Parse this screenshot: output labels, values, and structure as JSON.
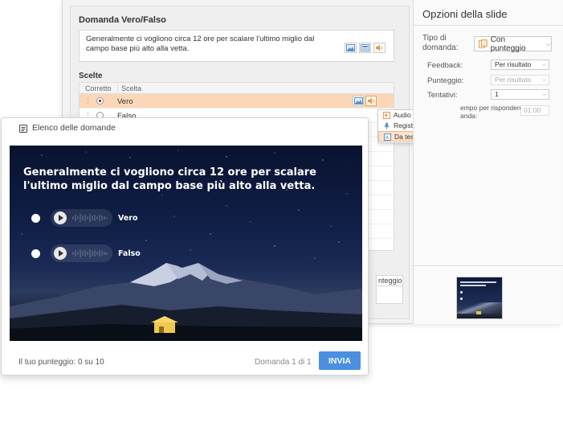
{
  "editor": {
    "question_section_title": "Domanda Vero/Falso",
    "question_text": "Generalmente ci vogliono circa 12 ore per scalare l'ultimo miglio dal campo base più alto alla vetta.",
    "choices_title": "Scelte",
    "columns": {
      "correct": "Corretto",
      "choice": "Scelta"
    },
    "choices": [
      {
        "label": "Vero",
        "correct": true,
        "selected": true
      },
      {
        "label": "Falso",
        "correct": false,
        "selected": false
      }
    ],
    "score_column_partial": "nteggio",
    "icons": [
      "image-icon",
      "slide-icon",
      "audio-icon",
      "drag-handle-icon"
    ]
  },
  "audio_menu": {
    "items": [
      {
        "label": "Audio da file",
        "icon": "audio-file-icon"
      },
      {
        "label": "Registra da Microfono...",
        "icon": "microphone-icon"
      },
      {
        "label": "Da testo a voce...",
        "icon": "text-to-speech-icon",
        "highlighted": true
      }
    ]
  },
  "slide_options": {
    "title": "Opzioni della slide",
    "question_type_label": "Tipo di domanda:",
    "question_type_value": "Con punteggio",
    "feedback_label": "Feedback:",
    "feedback_value": "Per risultato",
    "score_label": "Punteggio:",
    "score_value": "Per risultato",
    "attempts_label": "Tentativi:",
    "attempts_value": "1",
    "time_label_line1": "empo per rispondere",
    "time_label_line2": "anda:",
    "time_value": "01:00"
  },
  "preview": {
    "header_label": "Elenco delle domande",
    "question": "Generalmente ci vogliono circa 12 ore per scalare l'ultimo miglio dal campo base più alto alla vetta.",
    "answers": [
      "Vero",
      "Falso"
    ],
    "score_text": "Il tuo punteggio: 0 su 10",
    "question_counter": "Domanda 1 di 1",
    "submit_label": "INVIA"
  },
  "colors": {
    "accent_blue": "#4a8fe0",
    "selected_row": "#fbd7b7",
    "menu_highlight": "#fde3cc"
  }
}
